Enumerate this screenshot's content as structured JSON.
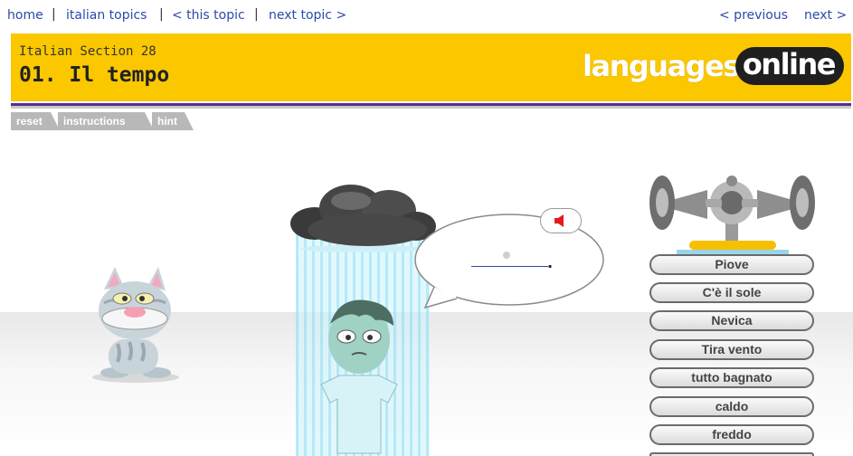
{
  "nav": {
    "home": "home",
    "italian_topics": "italian topics",
    "this_topic": "< this topic",
    "next_topic": "next topic >",
    "previous": "< previous",
    "next": "next >"
  },
  "header": {
    "section": "Italian Section 28",
    "title": "01. Il tempo",
    "logo_part1": "languages",
    "logo_part2": "online"
  },
  "tabs": {
    "reset": "reset",
    "instructions": "instructions",
    "hint": "hint"
  },
  "bubble": {
    "blank_period": "."
  },
  "options": [
    "Piove",
    "C'è il sole",
    "Nevica",
    "Tira vento",
    "tutto bagnato",
    "caldo",
    "freddo"
  ],
  "colors": {
    "header_bg": "#fbc800",
    "link": "#2b4aa8",
    "rule": "#5a2b8a"
  },
  "icons": {
    "speaker": "speaker-icon",
    "loudspeaker": "loudspeaker-icon",
    "cloud": "rain-cloud-icon"
  }
}
